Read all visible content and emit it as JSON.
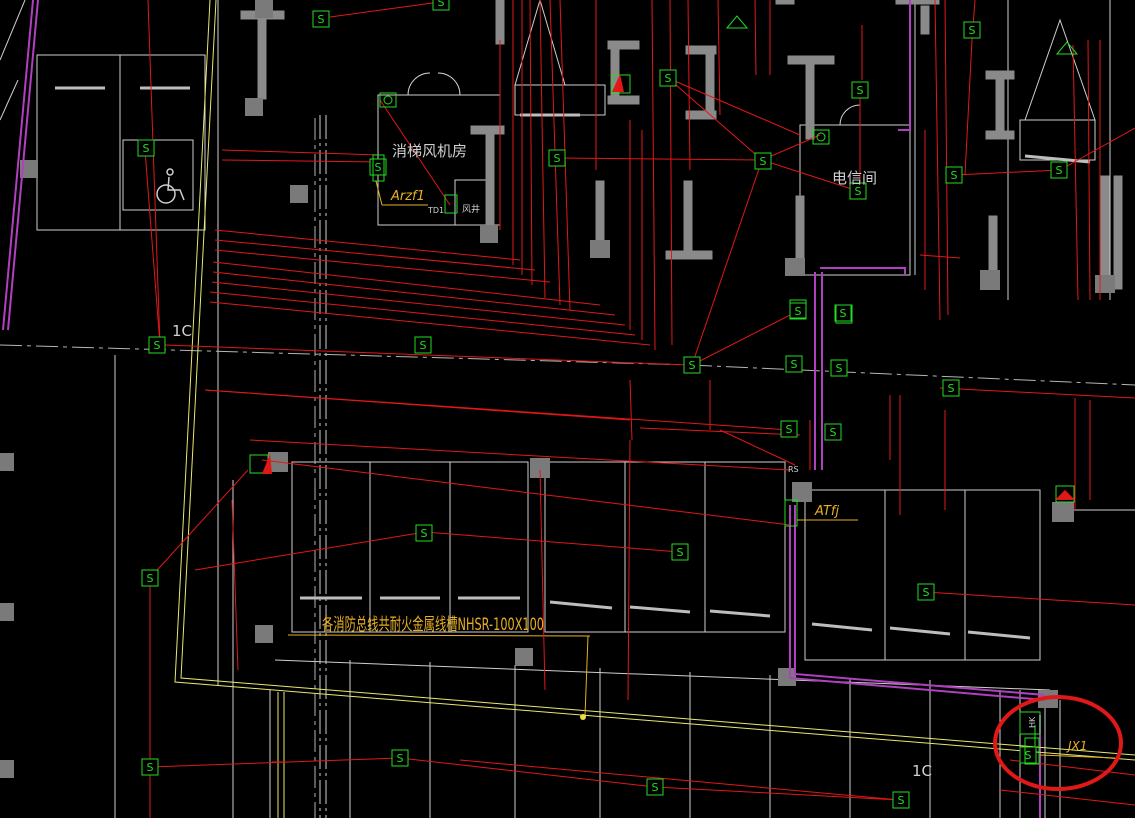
{
  "drawing": {
    "room_labels": {
      "fire_elevator_machine_room": "消梯风机房",
      "telecom_room": "电信间",
      "air_shaft": "风井"
    },
    "panel_labels": {
      "fire_panel": "Arzf1",
      "floor_panel": "ATfj",
      "junction_box": "JX1",
      "code_small": "TD1",
      "rs": "RS",
      "hk": "HK"
    },
    "axis_labels": {
      "axis_1c_left": "1C",
      "axis_1c_bottom": "1C"
    },
    "cable_tray_note": "各消防总线共耐火金属线槽NHSR-100X100",
    "sensor_symbol": "S",
    "annotation": {
      "color": "#e01818",
      "shape": "ellipse",
      "marks": "junction-box-area"
    },
    "colors": {
      "background": "#000000",
      "wiring": "#e01818",
      "device": "#22dd22",
      "wall": "#d8d8d8",
      "column": "#7a7a7a",
      "trunk": "#e8e870",
      "riser": "#b040c0",
      "text_yellow": "#e8b020",
      "text_white": "#d8d8d8"
    }
  }
}
